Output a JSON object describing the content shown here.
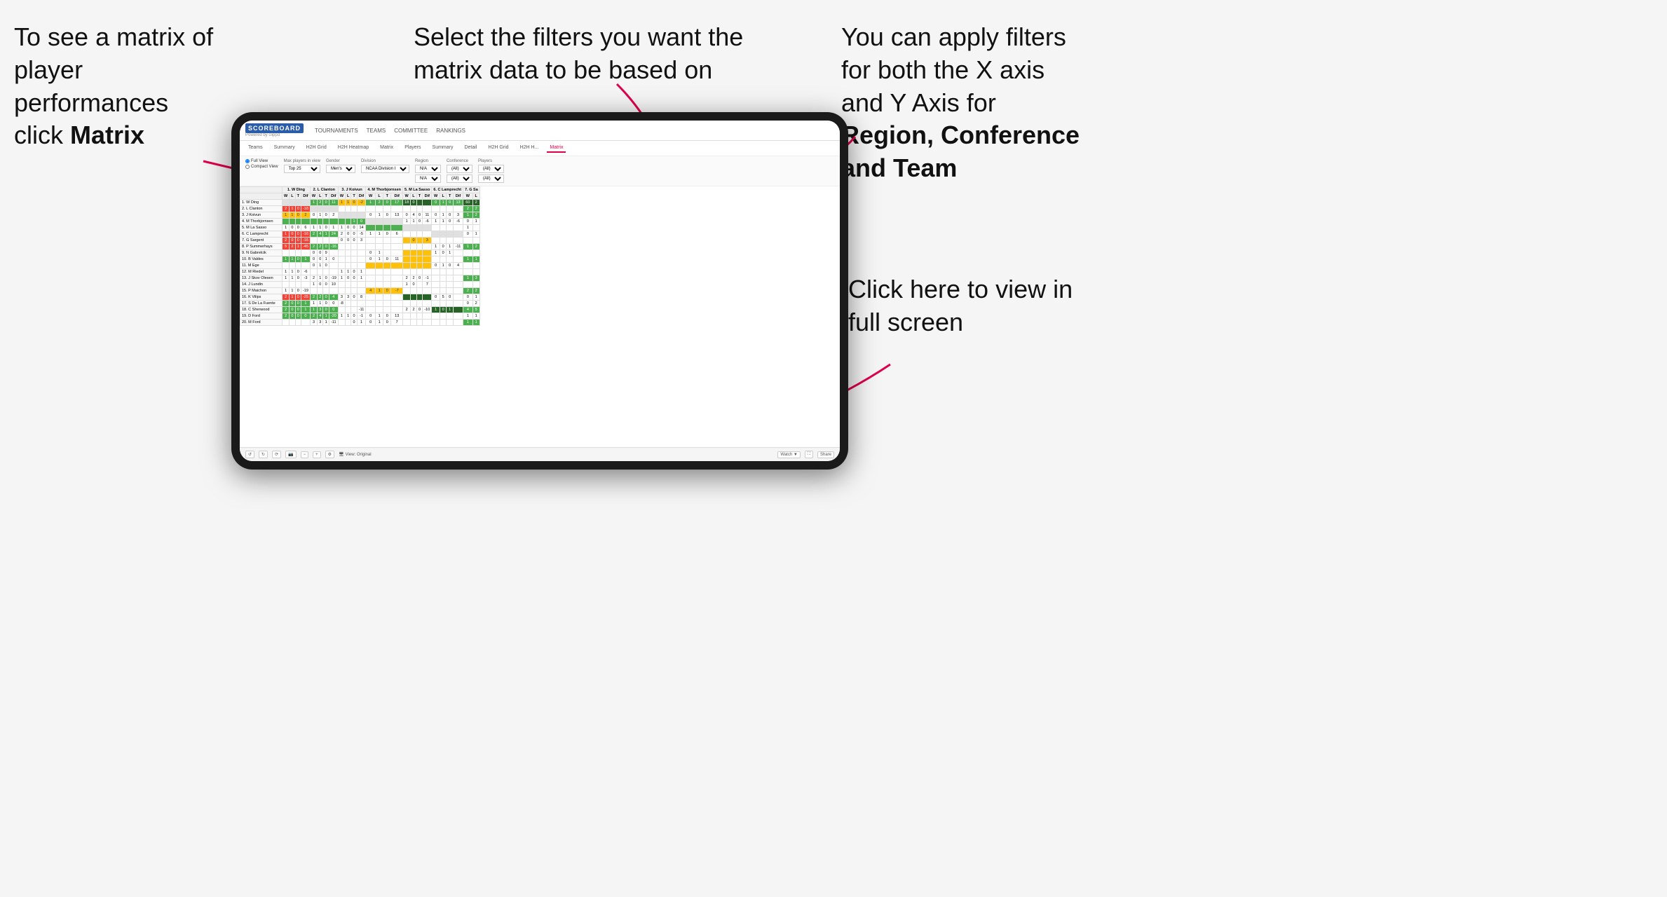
{
  "annotations": {
    "topleft": {
      "line1": "To see a matrix of",
      "line2": "player performances",
      "line3": "click ",
      "bold": "Matrix"
    },
    "topmid": {
      "text": "Select the filters you want the matrix data to be based on"
    },
    "topright": {
      "line1": "You  can apply filters for both the X axis and Y Axis for ",
      "bold": "Region, Conference and Team"
    },
    "bottomright": {
      "text": "Click here to view in full screen"
    }
  },
  "app": {
    "logo": "SCOREBOARD",
    "logo_sub": "Powered by clippd",
    "nav": [
      "TOURNAMENTS",
      "TEAMS",
      "COMMITTEE",
      "RANKINGS"
    ],
    "subnav": [
      "Teams",
      "Summary",
      "H2H Grid",
      "H2H Heatmap",
      "Matrix",
      "Players",
      "Summary",
      "Detail",
      "H2H Grid",
      "H2H H...",
      "Matrix"
    ],
    "active_tab": "Matrix"
  },
  "filters": {
    "view_options": [
      "Full View",
      "Compact View"
    ],
    "max_players": "Top 25",
    "gender": "Men's",
    "division": "NCAA Division I",
    "region_x": "N/A",
    "region_y": "N/A",
    "conference_x": "(All)",
    "conference_y": "(All)",
    "players_x": "(All)",
    "players_y": "(All)"
  },
  "column_headers": [
    "1. W Ding",
    "2. L Clanton",
    "3. J Koivun",
    "4. M Thorbjornsen",
    "5. M La Sasso",
    "6. C Lamprecht",
    "7. G Sa"
  ],
  "col_subheaders": [
    "W",
    "L",
    "T",
    "Dif"
  ],
  "rows": [
    {
      "name": "1. W Ding",
      "highlight": false
    },
    {
      "name": "2. L Clanton",
      "highlight": false
    },
    {
      "name": "3. J Koivun",
      "highlight": false
    },
    {
      "name": "4. M Thorbjornsen",
      "highlight": false
    },
    {
      "name": "5. M La Sasso",
      "highlight": false
    },
    {
      "name": "6. C Lamprecht",
      "highlight": false
    },
    {
      "name": "7. G Sargent",
      "highlight": false
    },
    {
      "name": "8. P Summerhays",
      "highlight": false
    },
    {
      "name": "9. N Gabrelcik",
      "highlight": false
    },
    {
      "name": "10. B Valdes",
      "highlight": false
    },
    {
      "name": "11. M Ege",
      "highlight": false
    },
    {
      "name": "12. M Riedel",
      "highlight": false
    },
    {
      "name": "13. J Skov Olesen",
      "highlight": false
    },
    {
      "name": "14. J Lundin",
      "highlight": false
    },
    {
      "name": "15. P Maichon",
      "highlight": false
    },
    {
      "name": "16. K Vilips",
      "highlight": false
    },
    {
      "name": "17. S De La Fuente",
      "highlight": false
    },
    {
      "name": "18. C Sherwood",
      "highlight": false
    },
    {
      "name": "19. D Ford",
      "highlight": false
    },
    {
      "name": "20. M Ford",
      "highlight": false
    }
  ],
  "toolbar": {
    "view_label": "View: Original",
    "watch_label": "Watch",
    "share_label": "Share"
  }
}
